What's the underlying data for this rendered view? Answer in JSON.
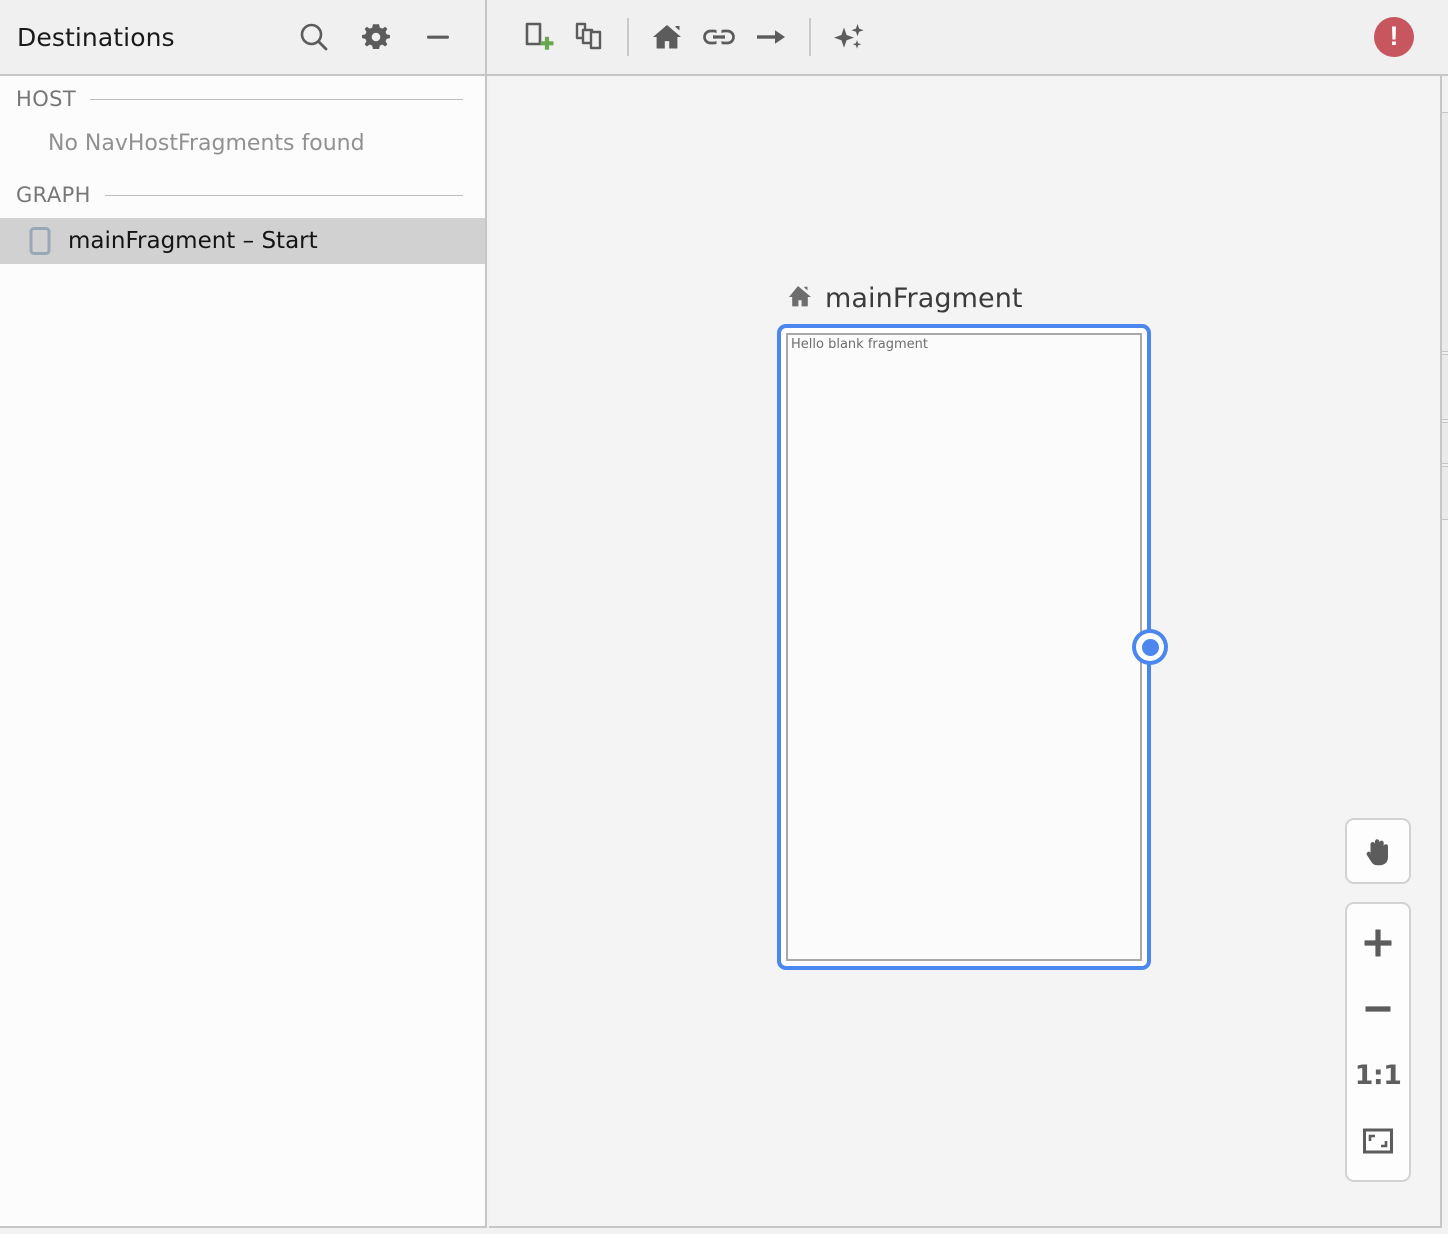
{
  "panel": {
    "title": "Destinations",
    "actions": [
      {
        "name": "search-icon",
        "label": "Search"
      },
      {
        "name": "gear-icon",
        "label": "Settings"
      },
      {
        "name": "minimize-icon",
        "label": "Hide"
      }
    ]
  },
  "toolbar": {
    "buttons": [
      {
        "name": "new-destination-icon",
        "label": "New Destination"
      },
      {
        "name": "new-nested-graph-icon",
        "label": "New Nested Graph"
      },
      {
        "name": "start-destination-icon",
        "label": "Assign start destination"
      },
      {
        "name": "add-deep-link-icon",
        "label": "Add deep link"
      },
      {
        "name": "add-action-icon",
        "label": "Add action"
      },
      {
        "name": "auto-arrange-icon",
        "label": "Auto Arrange"
      }
    ],
    "error_badge": {
      "name": "error-badge",
      "glyph": "!",
      "color": "#c8565f"
    }
  },
  "sidebar": {
    "groups": [
      {
        "header": "HOST",
        "empty_message": "No NavHostFragments found",
        "items": []
      },
      {
        "header": "GRAPH",
        "empty_message": "",
        "items": [
          {
            "label": "mainFragment – Start",
            "icon": "fragment-icon",
            "selected": true
          }
        ]
      }
    ]
  },
  "canvas": {
    "node": {
      "title": "mainFragment",
      "title_icon": "home-icon",
      "is_start_destination": true,
      "selected": true,
      "preview_text": "Hello blank fragment",
      "border_color": "#4b87ef",
      "handle": {
        "name": "connection-handle",
        "color": "#4b87ef"
      }
    }
  },
  "zoom_controls": {
    "pan": {
      "name": "pan-tool-button",
      "label": "Pan"
    },
    "zoom_in": {
      "name": "zoom-in-button",
      "label": "+"
    },
    "zoom_out": {
      "name": "zoom-out-button",
      "label": "−"
    },
    "actual_size": {
      "name": "actual-size-button",
      "label": "1:1"
    },
    "fit_screen": {
      "name": "fit-to-screen-button",
      "label": "Fit to screen"
    }
  }
}
